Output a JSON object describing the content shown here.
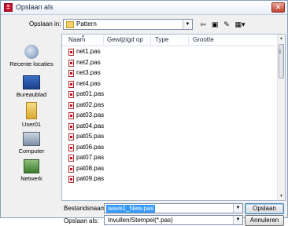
{
  "window": {
    "title": "Opslaan als",
    "app_icon": "app-icon",
    "close_label": "✕"
  },
  "lookin": {
    "label": "Opslaan in:",
    "folder": "Pattern"
  },
  "nav_tools": [
    {
      "name": "back-arrow-icon",
      "glyph": "⇦"
    },
    {
      "name": "up-folder-icon",
      "glyph": "▣"
    },
    {
      "name": "new-folder-icon",
      "glyph": "✎"
    },
    {
      "name": "view-menu-icon",
      "glyph": "▦▾"
    }
  ],
  "places": [
    {
      "label": "Recente locaties",
      "icon": "recent-places-icon"
    },
    {
      "label": "Bureaublad",
      "icon": "desktop-icon"
    },
    {
      "label": "User01",
      "icon": "user-folder-icon"
    },
    {
      "label": "Computer",
      "icon": "computer-icon"
    },
    {
      "label": "Netwerk",
      "icon": "network-icon"
    }
  ],
  "columns": [
    "Naam",
    "Gewijzigd op",
    "Type",
    "Grootte"
  ],
  "files": [
    "net1.pas",
    "net2.pas",
    "net3.pas",
    "net4.pas",
    "pat01.pas",
    "pat02.pas",
    "pat03.pas",
    "pat04.pas",
    "pat05.pas",
    "pat06.pas",
    "pat07.pas",
    "pat08.pas",
    "pat09.pas"
  ],
  "filename": {
    "label": "Bestandsnaam:",
    "value": "wave1_New.pas"
  },
  "filetype": {
    "label": "Opslaan als:",
    "value": "Invullen/Stempel(*.pas)"
  },
  "buttons": {
    "save": "Opslaan",
    "cancel": "Annuleren"
  },
  "colors": {
    "accent": "#3399ff",
    "file_icon": "#c8102e",
    "folder": "#f5d36b"
  }
}
